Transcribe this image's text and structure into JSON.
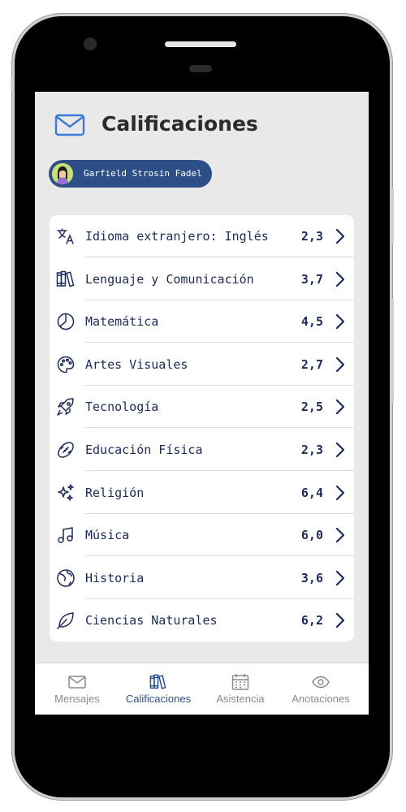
{
  "header": {
    "title": "Calificaciones",
    "icon": "mail-icon"
  },
  "student": {
    "name": "Garfield Strosin Fadel"
  },
  "subjects": [
    {
      "label": "Idioma extranjero: Inglés",
      "grade": "2,3",
      "icon": "translate-icon"
    },
    {
      "label": "Lenguaje y Comunicación",
      "grade": "3,7",
      "icon": "books-icon"
    },
    {
      "label": "Matemática",
      "grade": "4,5",
      "icon": "pie-chart-icon"
    },
    {
      "label": "Artes Visuales",
      "grade": "2,7",
      "icon": "palette-icon"
    },
    {
      "label": "Tecnología",
      "grade": "2,5",
      "icon": "rocket-icon"
    },
    {
      "label": "Educación Física",
      "grade": "2,3",
      "icon": "football-icon"
    },
    {
      "label": "Religión",
      "grade": "6,4",
      "icon": "sparkles-icon"
    },
    {
      "label": "Música",
      "grade": "6,0",
      "icon": "music-note-icon"
    },
    {
      "label": "Historia",
      "grade": "3,6",
      "icon": "globe-icon"
    },
    {
      "label": "Ciencias Naturales",
      "grade": "6,2",
      "icon": "leaf-icon"
    }
  ],
  "tabs": [
    {
      "label": "Mensajes",
      "icon": "mail-icon",
      "active": false
    },
    {
      "label": "Calificaciones",
      "icon": "books-icon",
      "active": true
    },
    {
      "label": "Asistencia",
      "icon": "calendar-icon",
      "active": false
    },
    {
      "label": "Anotaciones",
      "icon": "eye-icon",
      "active": false
    }
  ],
  "colors": {
    "primary": "#2d4f88",
    "text_dark": "#1c2b57",
    "accent_icon": "#3a7bd5",
    "muted": "#8a8a8a"
  }
}
